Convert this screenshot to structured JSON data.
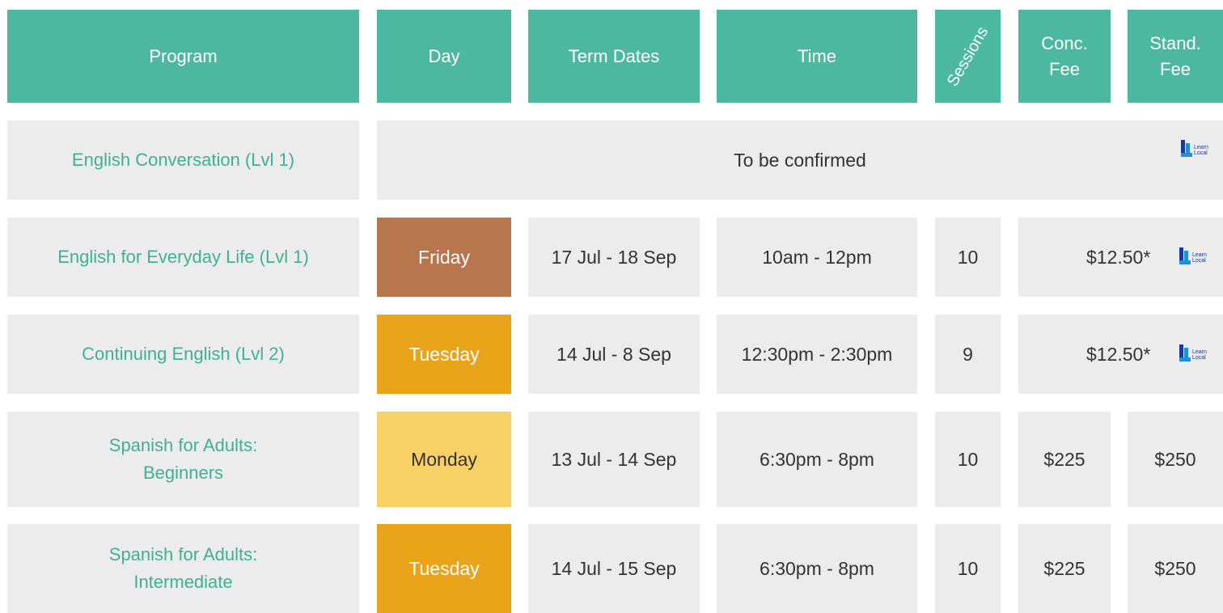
{
  "header": {
    "program": "Program",
    "day": "Day",
    "term_dates": "Term Dates",
    "time": "Time",
    "sessions": "Sessions",
    "conc_fee_line1": "Conc.",
    "conc_fee_line2": "Fee",
    "stand_fee_line1": "Stand.",
    "stand_fee_line2": "Fee"
  },
  "logo": {
    "line1": "Learn",
    "line2": "Local"
  },
  "rows": [
    {
      "program": "English Conversation (Lvl 1)",
      "notice": "To be confirmed",
      "logo": true
    },
    {
      "program": "English for Everyday Life (Lvl 1)",
      "day": "Friday",
      "term_dates": "17 Jul - 18 Sep",
      "time": "10am - 12pm",
      "sessions": "10",
      "fee": "$12.50*",
      "logo": true
    },
    {
      "program": "Continuing English (Lvl 2)",
      "day": "Tuesday",
      "term_dates": "14 Jul - 8 Sep",
      "time": "12:30pm - 2:30pm",
      "sessions": "9",
      "fee": "$12.50*",
      "logo": true
    },
    {
      "program_line1": "Spanish for Adults:",
      "program_line2": "Beginners",
      "day": "Monday",
      "term_dates": "13 Jul - 14 Sep",
      "time": "6:30pm - 8pm",
      "sessions": "10",
      "conc_fee": "$225",
      "stand_fee": "$250"
    },
    {
      "program_line1": "Spanish for Adults:",
      "program_line2": "Intermediate",
      "day": "Tuesday",
      "term_dates": "14 Jul - 15 Sep",
      "time": "6:30pm - 8pm",
      "sessions": "10",
      "conc_fee": "$225",
      "stand_fee": "$250"
    }
  ],
  "colors": {
    "header_bg": "#4db8a0",
    "program_text": "#3fb193",
    "cell_bg": "#ececec",
    "friday": "#b8764c",
    "tuesday": "#e9a41a",
    "monday": "#f7d066"
  }
}
